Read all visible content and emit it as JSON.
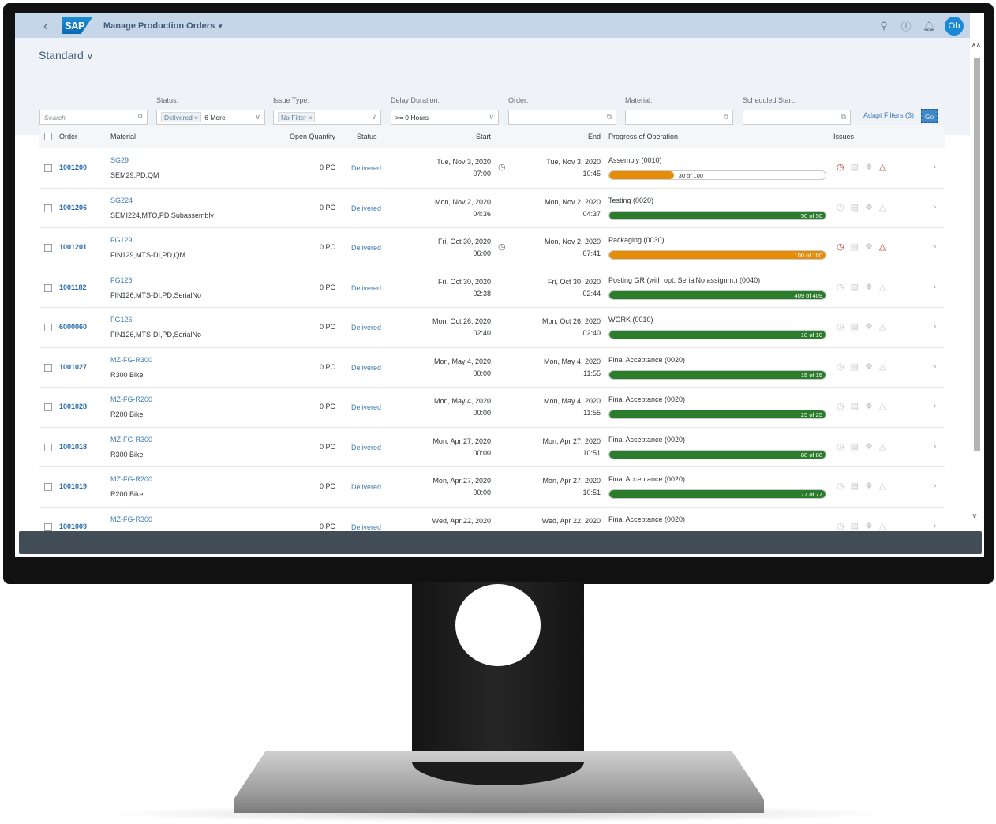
{
  "shell": {
    "back_icon": "chevron-left-icon",
    "logo": "SAP",
    "app_title": "Manage Production Orders",
    "icons": [
      "search-icon",
      "help-icon",
      "bell-icon"
    ],
    "avatar_initials": "Ob"
  },
  "filters": {
    "variant": "Standard",
    "search_placeholder": "Search",
    "status_label": "Status:",
    "status_token": "Delivered ×",
    "status_more": "6 More",
    "issue_type_label": "Issue Type:",
    "issue_type_token": "No Filter ×",
    "delay_label": "Delay Duration:",
    "delay_value": ">= 0 Hours",
    "order_label": "Order:",
    "material_label": "Material:",
    "scheduled_start_label": "Scheduled Start:",
    "adapt_filters": "Adapt Filters (3)",
    "go": "Go"
  },
  "table": {
    "columns": [
      "Order",
      "Material",
      "Open Quantity",
      "Status",
      "Start",
      "End",
      "Progress of Operation",
      "Issues"
    ],
    "rows": [
      {
        "order": "1001200",
        "material_id": "SG29",
        "material_desc": "SEM29,PD,QM",
        "qty": "0  PC",
        "status": "Delivered",
        "start_date": "Tue, Nov 3, 2020",
        "start_time": "07:00",
        "delay": true,
        "end_date": "Tue, Nov 3, 2020",
        "end_time": "10:45",
        "operation": "Assembly (0010)",
        "progress_done": 30,
        "progress_total": 100,
        "progress_label": "30 of 100",
        "progress_color": "#e78c07",
        "issue_alert": true
      },
      {
        "order": "1001206",
        "material_id": "SG224",
        "material_desc": "SEMI224,MTO,PD,Subassembly",
        "qty": "0  PC",
        "status": "Delivered",
        "start_date": "Mon, Nov 2, 2020",
        "start_time": "04:36",
        "delay": false,
        "end_date": "Mon, Nov 2, 2020",
        "end_time": "04:37",
        "operation": "Testing (0020)",
        "progress_done": 50,
        "progress_total": 50,
        "progress_label": "50 of 50",
        "progress_color": "#2b7c2b",
        "issue_alert": false
      },
      {
        "order": "1001201",
        "material_id": "FG129",
        "material_desc": "FIN129,MTS-DI,PD,QM",
        "qty": "0  PC",
        "status": "Delivered",
        "start_date": "Fri, Oct 30, 2020",
        "start_time": "06:00",
        "delay": true,
        "end_date": "Mon, Nov 2, 2020",
        "end_time": "07:41",
        "operation": "Packaging (0030)",
        "progress_done": 100,
        "progress_total": 100,
        "progress_label": "100 of 100",
        "progress_color": "#e78c07",
        "issue_alert": true
      },
      {
        "order": "1001182",
        "material_id": "FG126",
        "material_desc": "FIN126,MTS-DI,PD,SerialNo",
        "qty": "0  PC",
        "status": "Delivered",
        "start_date": "Fri, Oct 30, 2020",
        "start_time": "02:38",
        "delay": false,
        "end_date": "Fri, Oct 30, 2020",
        "end_time": "02:44",
        "operation": "Posting GR (with opt. SerialNo assignm.) (0040)",
        "progress_done": 409,
        "progress_total": 409,
        "progress_label": "409 of 409",
        "progress_color": "#2b7c2b",
        "issue_alert": false
      },
      {
        "order": "6000060",
        "material_id": "FG126",
        "material_desc": "FIN126,MTS-DI,PD,SerialNo",
        "qty": "0  PC",
        "status": "Delivered",
        "start_date": "Mon, Oct 26, 2020",
        "start_time": "02:40",
        "delay": false,
        "end_date": "Mon, Oct 26, 2020",
        "end_time": "02:40",
        "operation": "WORK (0010)",
        "progress_done": 10,
        "progress_total": 10,
        "progress_label": "10 of 10",
        "progress_color": "#2b7c2b",
        "issue_alert": false
      },
      {
        "order": "1001027",
        "material_id": "MZ-FG-R300",
        "material_desc": "R300 Bike",
        "qty": "0  PC",
        "status": "Delivered",
        "start_date": "Mon, May 4, 2020",
        "start_time": "00:00",
        "delay": false,
        "end_date": "Mon, May 4, 2020",
        "end_time": "11:55",
        "operation": "Final Acceptance (0020)",
        "progress_done": 15,
        "progress_total": 15,
        "progress_label": "15 of 15",
        "progress_color": "#2b7c2b",
        "issue_alert": false
      },
      {
        "order": "1001028",
        "material_id": "MZ-FG-R200",
        "material_desc": "R200 Bike",
        "qty": "0  PC",
        "status": "Delivered",
        "start_date": "Mon, May 4, 2020",
        "start_time": "00:00",
        "delay": false,
        "end_date": "Mon, May 4, 2020",
        "end_time": "11:55",
        "operation": "Final Acceptance (0020)",
        "progress_done": 25,
        "progress_total": 25,
        "progress_label": "25 of 25",
        "progress_color": "#2b7c2b",
        "issue_alert": false
      },
      {
        "order": "1001018",
        "material_id": "MZ-FG-R300",
        "material_desc": "R300 Bike",
        "qty": "0  PC",
        "status": "Delivered",
        "start_date": "Mon, Apr 27, 2020",
        "start_time": "00:00",
        "delay": false,
        "end_date": "Mon, Apr 27, 2020",
        "end_time": "10:51",
        "operation": "Final Acceptance (0020)",
        "progress_done": 88,
        "progress_total": 88,
        "progress_label": "88 of 88",
        "progress_color": "#2b7c2b",
        "issue_alert": false
      },
      {
        "order": "1001019",
        "material_id": "MZ-FG-R200",
        "material_desc": "R200 Bike",
        "qty": "0  PC",
        "status": "Delivered",
        "start_date": "Mon, Apr 27, 2020",
        "start_time": "00:00",
        "delay": false,
        "end_date": "Mon, Apr 27, 2020",
        "end_time": "10:51",
        "operation": "Final Acceptance (0020)",
        "progress_done": 77,
        "progress_total": 77,
        "progress_label": "77 of 77",
        "progress_color": "#2b7c2b",
        "issue_alert": false
      },
      {
        "order": "1001009",
        "material_id": "MZ-FG-R300",
        "material_desc": "",
        "qty": "0  PC",
        "status": "Delivered",
        "start_date": "Wed, Apr 22, 2020",
        "start_time": "",
        "delay": false,
        "end_date": "Wed, Apr 22, 2020",
        "end_time": "",
        "operation": "Final Acceptance (0020)",
        "progress_done": null,
        "progress_total": null,
        "progress_label": "",
        "progress_color": "#2b7c2b",
        "issue_alert": false
      }
    ]
  },
  "colors": {
    "shell_bg": "#c5d6e8",
    "link": "#3f7cb6",
    "progress_warning": "#e78c07",
    "progress_success": "#2b7c2b",
    "issue_alert": "#c0392b"
  }
}
